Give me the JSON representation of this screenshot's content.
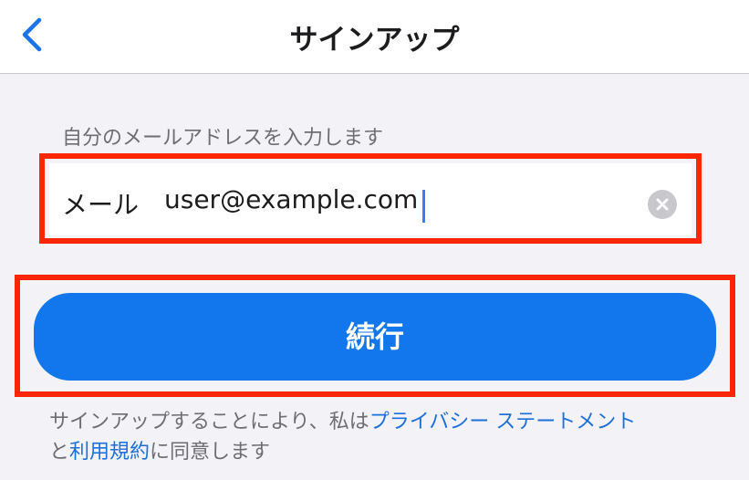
{
  "header": {
    "title": "サインアップ",
    "back_icon": "chevron-left-icon",
    "accent_color": "#1a73e8"
  },
  "form": {
    "caption": "自分のメールアドレスを入力します",
    "email_label": "メール",
    "email_value": "user@example.com",
    "clear_icon": "clear-circle-icon"
  },
  "actions": {
    "continue_label": "続行",
    "button_color": "#1277ec"
  },
  "legal": {
    "prefix": "サインアップすることにより、私は",
    "privacy_link": "プライバシー ステートメント",
    "connector": "と",
    "terms_link": "利用規約",
    "suffix": "に同意します"
  },
  "highlight_color": "#ff2600"
}
